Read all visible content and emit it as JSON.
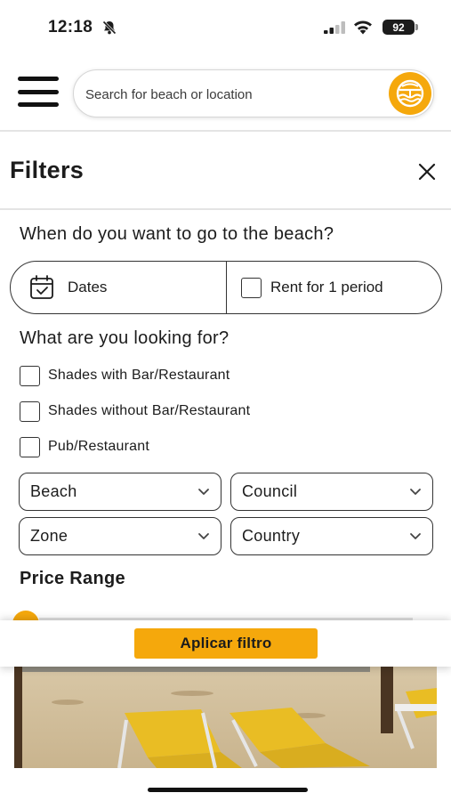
{
  "status_bar": {
    "time": "12:18",
    "battery": "92"
  },
  "search": {
    "placeholder": "Search for beach or location"
  },
  "filters": {
    "title": "Filters"
  },
  "when": {
    "question": "When do you want to go to the beach?",
    "dates_label": "Dates",
    "rent_label": "Rent for 1 period"
  },
  "looking": {
    "question": "What are you looking for?",
    "options": [
      {
        "label": "Shades with Bar/Restaurant",
        "checked": false
      },
      {
        "label": "Shades without Bar/Restaurant",
        "checked": false
      },
      {
        "label": "Pub/Restaurant",
        "checked": false
      }
    ]
  },
  "selects": {
    "beach": "Beach",
    "council": "Council",
    "zone": "Zone",
    "country": "Country"
  },
  "price": {
    "label": "Price Range"
  },
  "apply": {
    "label": "Aplicar filtro"
  },
  "colors": {
    "accent": "#f5a80c",
    "text": "#1c1c1c",
    "border": "#333333"
  },
  "icons": [
    "bell-off-icon",
    "signal-icon",
    "wifi-icon",
    "battery-icon",
    "menu-icon",
    "beach-logo-icon",
    "close-icon",
    "calendar-icon",
    "chevron-down-icon"
  ]
}
